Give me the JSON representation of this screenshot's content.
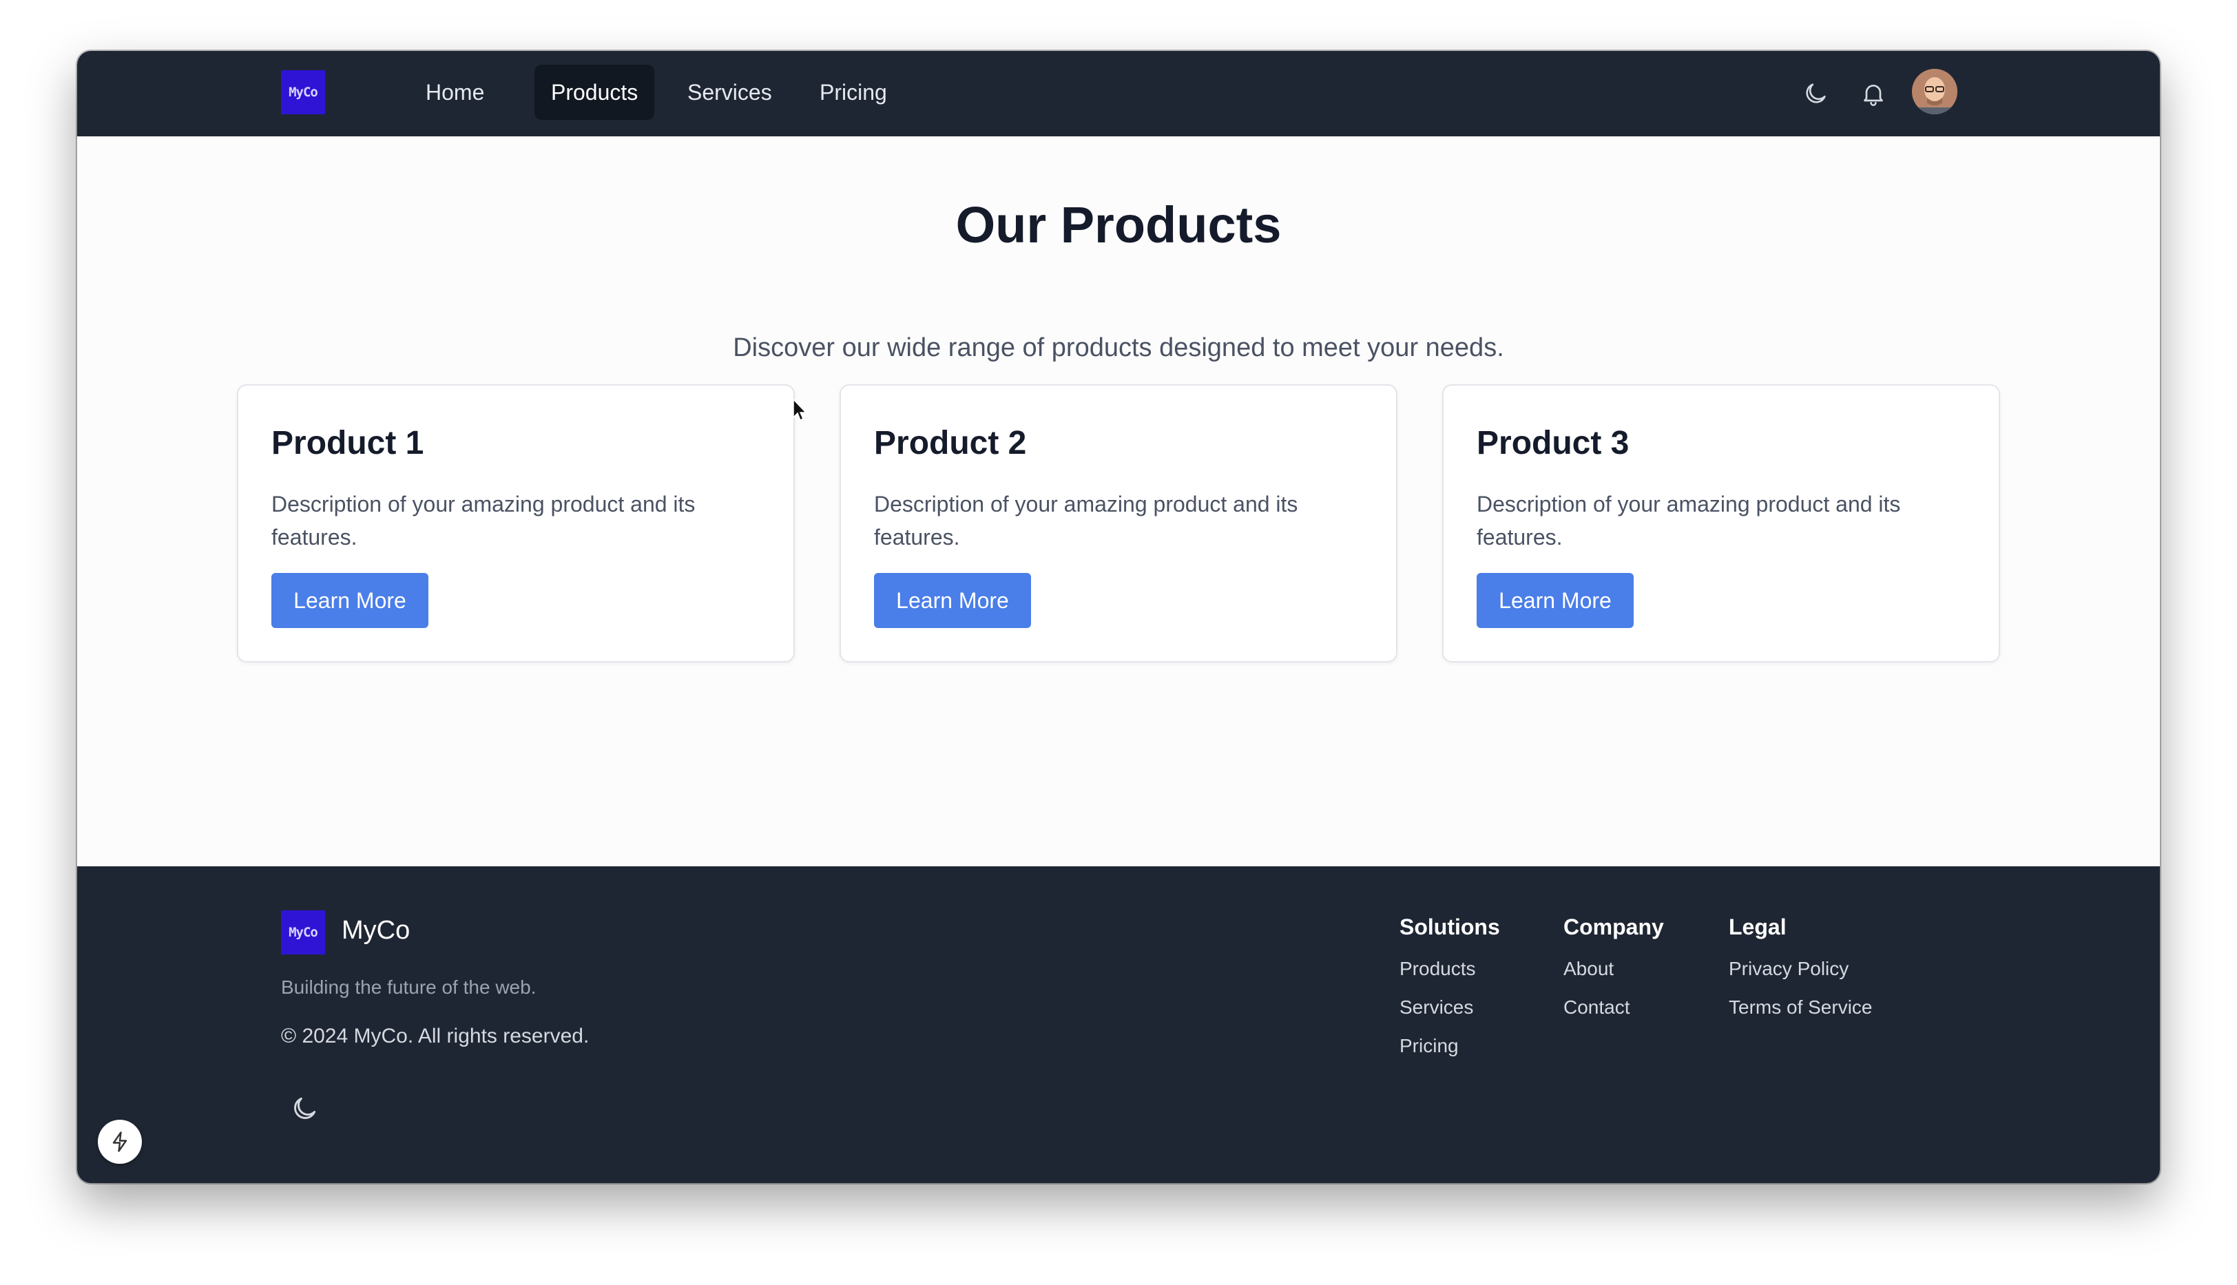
{
  "brand": {
    "logo_text": "MyCo",
    "name": "MyCo",
    "color": "#2f14d6"
  },
  "nav": {
    "items": [
      {
        "label": "Home",
        "active": false
      },
      {
        "label": "Products",
        "active": true
      },
      {
        "label": "Services",
        "active": false
      },
      {
        "label": "Pricing",
        "active": false
      }
    ],
    "icons": [
      "moon-icon",
      "bell-icon",
      "avatar"
    ]
  },
  "main": {
    "title": "Our Products",
    "subtitle": "Discover our wide range of products designed to meet your needs.",
    "cards": [
      {
        "title": "Product 1",
        "description": "Description of your amazing product and its features.",
        "button": "Learn More"
      },
      {
        "title": "Product 2",
        "description": "Description of your amazing product and its features.",
        "button": "Learn More"
      },
      {
        "title": "Product 3",
        "description": "Description of your amazing product and its features.",
        "button": "Learn More"
      }
    ]
  },
  "footer": {
    "brand": "MyCo",
    "tagline": "Building the future of the web.",
    "copyright": "© 2024 MyCo. All rights reserved.",
    "columns": [
      {
        "title": "Solutions",
        "links": [
          "Products",
          "Services",
          "Pricing"
        ]
      },
      {
        "title": "Company",
        "links": [
          "About",
          "Contact"
        ]
      },
      {
        "title": "Legal",
        "links": [
          "Privacy Policy",
          "Terms of Service"
        ]
      }
    ]
  },
  "colors": {
    "navbar_bg": "#1f2633",
    "accent_button": "#4a7ee8",
    "page_bg": "#fcfcfc"
  }
}
